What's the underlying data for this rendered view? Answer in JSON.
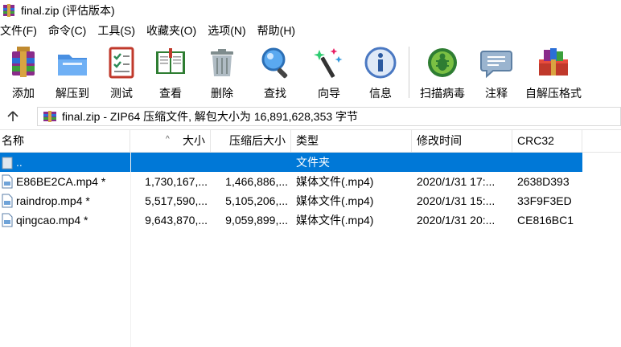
{
  "window": {
    "title": "final.zip (评估版本)"
  },
  "menu": [
    "文件(F)",
    "命令(C)",
    "工具(S)",
    "收藏夹(O)",
    "选项(N)",
    "帮助(H)"
  ],
  "toolbar": {
    "add": "添加",
    "extract": "解压到",
    "test": "测试",
    "view": "查看",
    "delete": "删除",
    "find": "查找",
    "wizard": "向导",
    "info": "信息",
    "scan": "扫描病毒",
    "comment": "注释",
    "sfx": "自解压格式"
  },
  "address": {
    "text": "final.zip - ZIP64 压缩文件, 解包大小为 16,891,628,353 字节"
  },
  "columns": {
    "name": "名称",
    "size": "大小",
    "packed": "压缩后大小",
    "type": "类型",
    "modified": "修改时间",
    "crc": "CRC32"
  },
  "rows": [
    {
      "name": "..",
      "size": "",
      "packed": "",
      "type": "文件夹",
      "modified": "",
      "crc": ""
    },
    {
      "name": "E86BE2CA.mp4 *",
      "size": "1,730,167,...",
      "packed": "1,466,886,...",
      "type": "媒体文件(.mp4)",
      "modified": "2020/1/31 17:...",
      "crc": "2638D393"
    },
    {
      "name": "raindrop.mp4 *",
      "size": "5,517,590,...",
      "packed": "5,105,206,...",
      "type": "媒体文件(.mp4)",
      "modified": "2020/1/31 15:...",
      "crc": "33F9F3ED"
    },
    {
      "name": "qingcao.mp4 *",
      "size": "9,643,870,...",
      "packed": "9,059,899,...",
      "type": "媒体文件(.mp4)",
      "modified": "2020/1/31 20:...",
      "crc": "CE816BC1"
    }
  ],
  "colors": {
    "selection": "#0078d7"
  }
}
